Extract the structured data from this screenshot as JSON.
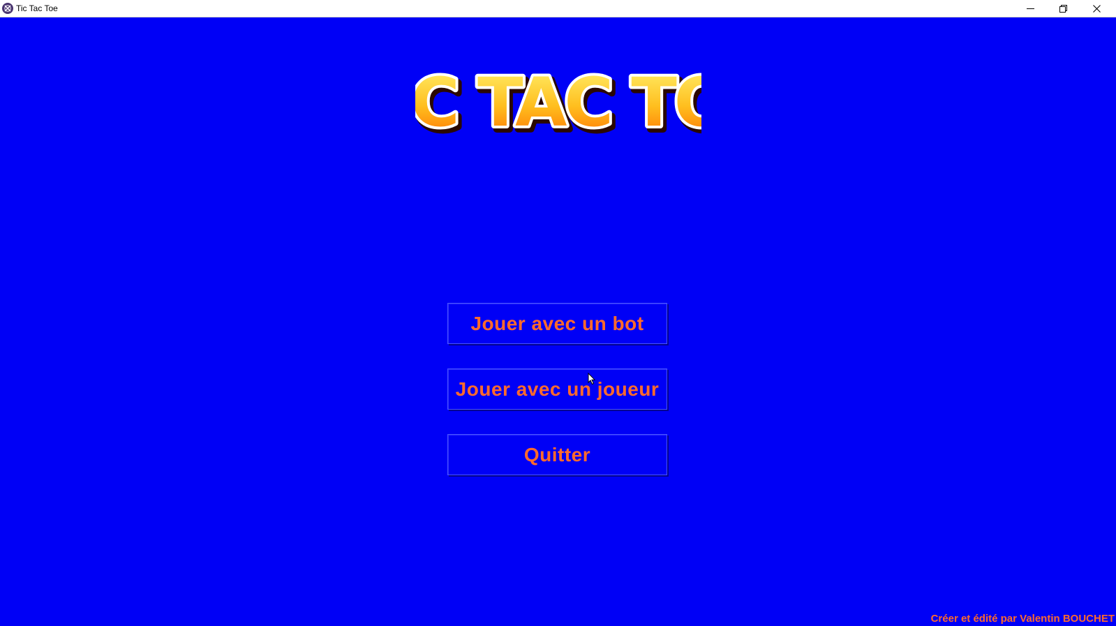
{
  "window": {
    "title": "Tic Tac Toe",
    "app_icon": "app-icon",
    "controls": [
      "minimize-icon",
      "maximize-icon",
      "close-icon"
    ]
  },
  "logo": {
    "text": "TIC TAC TOE",
    "colors": {
      "fill_top": "#fff06a",
      "fill_bottom": "#ff7a00",
      "outline": "#ffffff",
      "shadow": "#3a0a00"
    }
  },
  "menu": {
    "play_bot_label": "Jouer avec un bot",
    "play_player_label": "Jouer avec un joueur",
    "quit_label": "Quitter"
  },
  "footer": {
    "credits": "Créer et édité par Valentin BOUCHET"
  },
  "colors": {
    "background": "#0000f6",
    "button_text": "#ff6a2c"
  }
}
